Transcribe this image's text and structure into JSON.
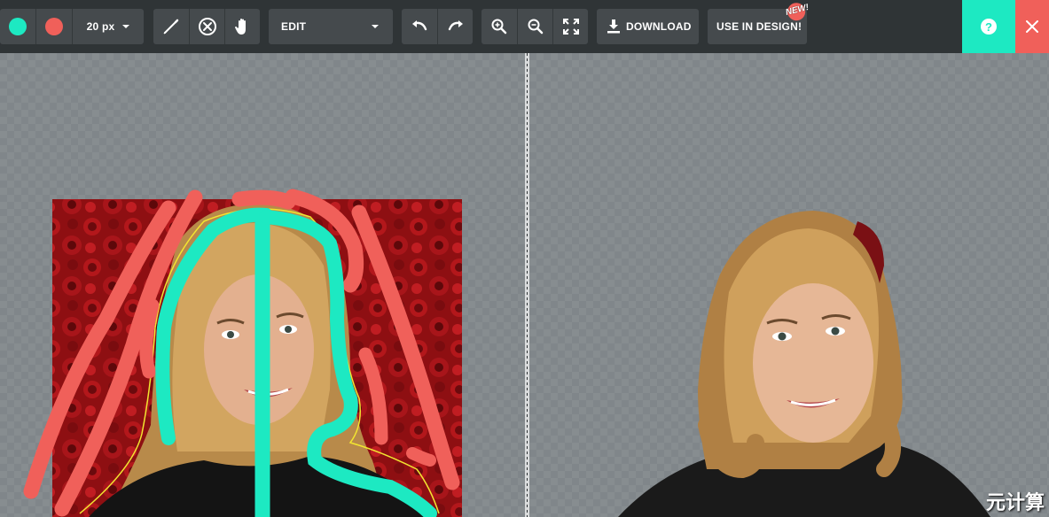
{
  "toolbar": {
    "brush_size": "20 px",
    "mode_select": "EDIT",
    "download_label": "DOWNLOAD",
    "use_in_design_label": "USE IN DESIGN!",
    "new_badge": "NEW!",
    "help_glyph": "?"
  },
  "colors": {
    "keep_marker": "#1de9c2",
    "remove_marker": "#f0605a",
    "toolbar_bg": "#2f3436",
    "button_bg": "#454a4d",
    "help_bg": "#1de9c2",
    "close_bg": "#f0605a"
  },
  "icons": {
    "keep": "keep-color-icon",
    "remove": "remove-color-icon",
    "pencil": "pencil-icon",
    "eraser": "eraser-icon",
    "hand": "hand-icon",
    "undo": "undo-icon",
    "redo": "redo-icon",
    "zoom_in": "zoom-in-icon",
    "zoom_out": "zoom-out-icon",
    "fit": "fit-screen-icon",
    "download": "download-icon",
    "help": "help-icon",
    "close": "close-icon"
  },
  "watermark": "元计算"
}
